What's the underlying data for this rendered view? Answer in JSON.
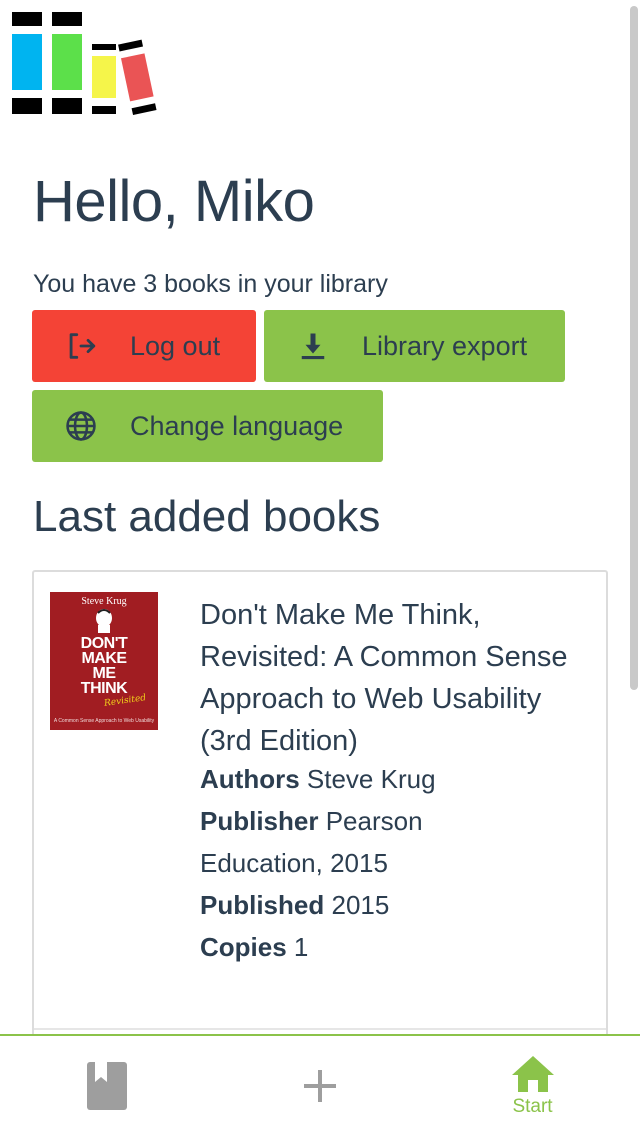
{
  "greeting": "Hello, Miko",
  "library_count_text": "You have 3 books in your library",
  "buttons": {
    "logout": "Log out",
    "export": "Library export",
    "language": "Change language"
  },
  "section_title": "Last added books",
  "book": {
    "cover": {
      "author": "Steve Krug",
      "title_lines": [
        "DON'T",
        "MAKE",
        "ME",
        "THINK"
      ],
      "revisited": "Revisited",
      "subtitle": "A Common Sense Approach to Web Usability"
    },
    "title": "Don't Make Me Think, Revisited: A Common Sense Approach to Web Usability (3rd Edition)",
    "authors_label": "Authors",
    "authors_value": "Steve Krug",
    "publisher_label": "Publisher",
    "publisher_value": "Pearson Education, 2015",
    "published_label": "Published",
    "published_value": "2015",
    "copies_label": "Copies",
    "copies_value": "1"
  },
  "nav": {
    "books_icon": "book-icon",
    "add_icon": "plus-icon",
    "start_icon": "home-icon",
    "start_label": "Start"
  },
  "colors": {
    "logout_red": "#f44336",
    "accent_green": "#8bc34a",
    "text": "#2c3e50"
  }
}
